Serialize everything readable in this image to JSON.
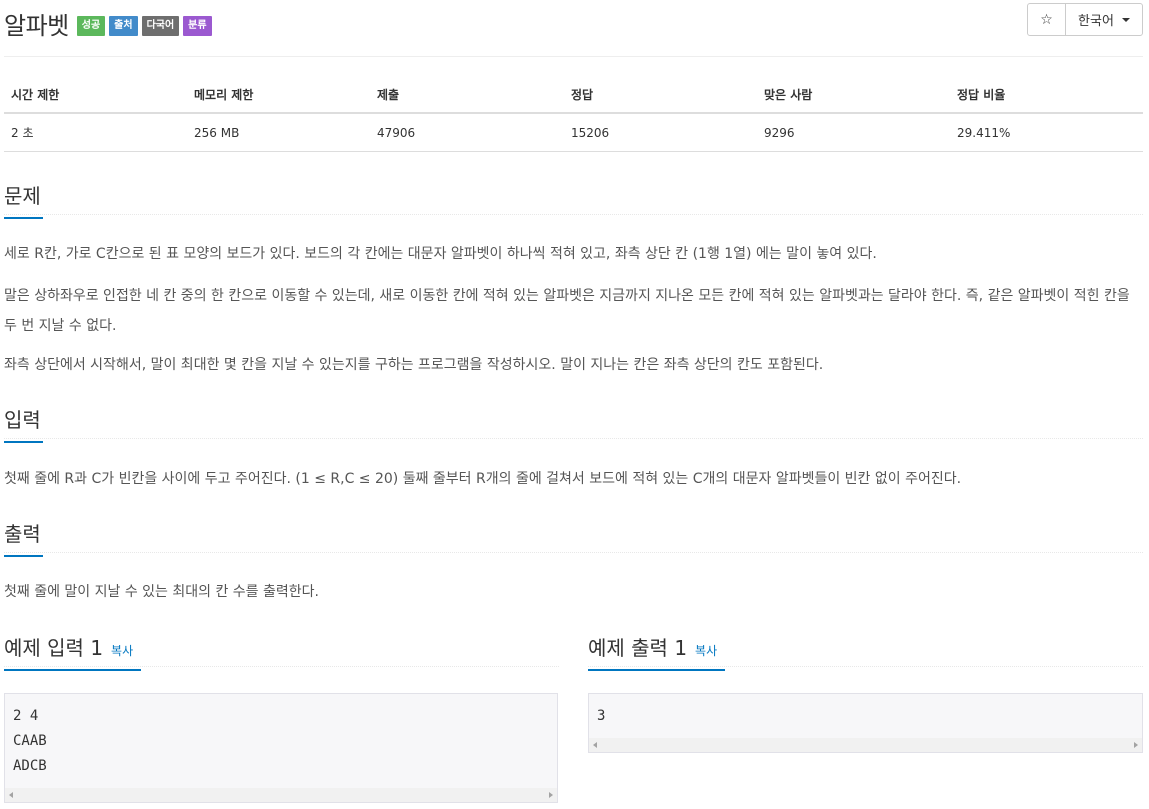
{
  "problem": {
    "title": "알파벳",
    "badges": [
      {
        "label": "성공",
        "color": "#5cb85c"
      },
      {
        "label": "출처",
        "color": "#428bca"
      },
      {
        "label": "다국어",
        "color": "#6e6e6e"
      },
      {
        "label": "분류",
        "color": "#9b59d0"
      }
    ]
  },
  "toolbar": {
    "star_icon": "☆",
    "language": "한국어"
  },
  "info_table": {
    "headers": [
      "시간 제한",
      "메모리 제한",
      "제출",
      "정답",
      "맞은 사람",
      "정답 비율"
    ],
    "values": [
      "2 초",
      "256 MB",
      "47906",
      "15206",
      "9296",
      "29.411%"
    ]
  },
  "sections": {
    "problem_heading": "문제",
    "problem_paragraphs": [
      "세로 R칸, 가로 C칸으로 된 표 모양의 보드가 있다. 보드의 각 칸에는 대문자 알파벳이 하나씩 적혀 있고, 좌측 상단 칸 (1행 1열) 에는 말이 놓여 있다.",
      "말은 상하좌우로 인접한 네 칸 중의 한 칸으로 이동할 수 있는데, 새로 이동한 칸에 적혀 있는 알파벳은 지금까지 지나온 모든 칸에 적혀 있는 알파벳과는 달라야 한다. 즉, 같은 알파벳이 적힌 칸을 두 번 지날 수 없다.",
      "좌측 상단에서 시작해서, 말이 최대한 몇 칸을 지날 수 있는지를 구하는 프로그램을 작성하시오. 말이 지나는 칸은 좌측 상단의 칸도 포함된다."
    ],
    "input_heading": "입력",
    "input_text": "첫째 줄에 R과 C가 빈칸을 사이에 두고 주어진다. (1 ≤ R,C ≤ 20) 둘째 줄부터 R개의 줄에 걸쳐서 보드에 적혀 있는 C개의 대문자 알파벳들이 빈칸 없이 주어진다.",
    "output_heading": "출력",
    "output_text": "첫째 줄에 말이 지날 수 있는 최대의 칸 수를 출력한다."
  },
  "samples": {
    "input_heading": "예제 입력 1",
    "output_heading": "예제 출력 1",
    "copy_label": "복사",
    "input_text": "2 4\nCAAB\nADCB",
    "output_text": "3"
  }
}
